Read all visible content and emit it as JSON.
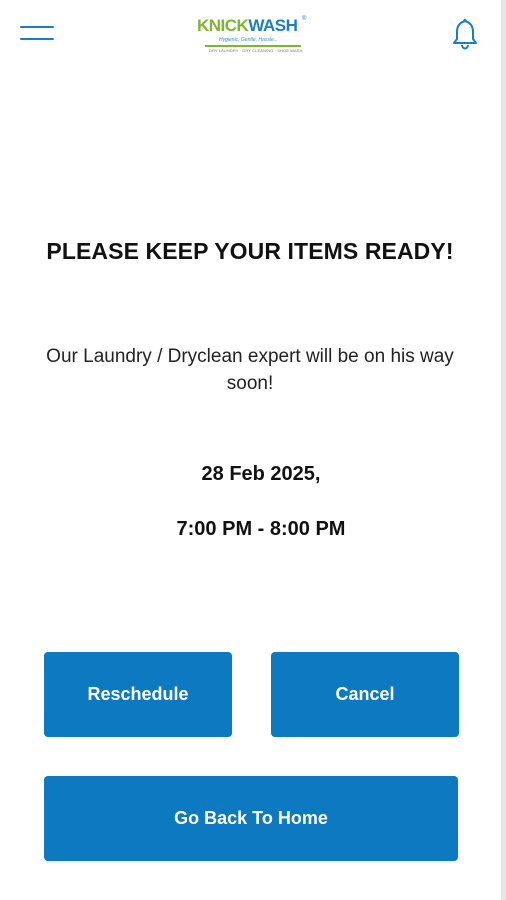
{
  "header": {
    "menu_icon": "hamburger-menu-icon",
    "logo": {
      "part1": "K",
      "part2": "NICK",
      "part3": "WASH",
      "registered": "®",
      "tagline": "Hygienic, Gentle, Hassle...",
      "services": "DRY LAUNDRY · DRY CLEANING · SHOE WASH"
    },
    "notification_icon": "bell-icon"
  },
  "main": {
    "headline": "PLEASE KEEP YOUR ITEMS READY!",
    "message": "Our Laundry / Dryclean expert will be on his way soon!",
    "date": "28 Feb 2025,",
    "time_slot": "7:00 PM - 8:00 PM"
  },
  "actions": {
    "reschedule_label": "Reschedule",
    "cancel_label": "Cancel",
    "home_label": "Go Back To Home"
  },
  "colors": {
    "accent": "#0d79c0",
    "brand_green": "#7cb82f",
    "brand_blue": "#1a7fbf",
    "background": "#ffffff",
    "text": "#111111"
  }
}
